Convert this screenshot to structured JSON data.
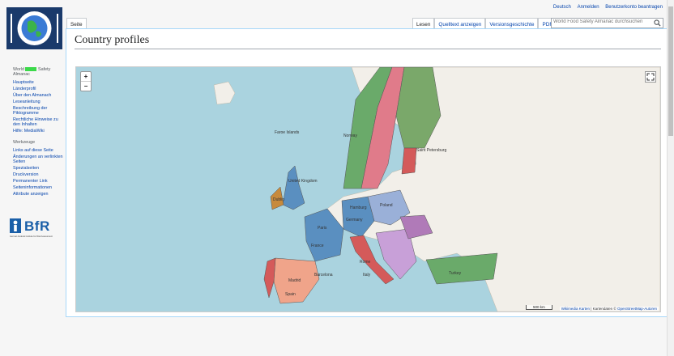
{
  "personal": {
    "language": "Deutsch",
    "login": "Anmelden",
    "account": "Benutzerkonto beantragen"
  },
  "tabs": {
    "page": "Seite",
    "read": "Lesen",
    "source": "Quelltext anzeigen",
    "history": "Versionsgeschichte",
    "pdf": "PDF-Export"
  },
  "search": {
    "placeholder": "World Food Safety Almanac durchsuchen"
  },
  "page": {
    "title": "Country profiles"
  },
  "sidebar": {
    "site_title_pre": "World",
    "site_title_post": "Safety Almanac",
    "nav": [
      "Hauptseite",
      "Länderprofil",
      "Über den Almanach",
      "Leseanleitung",
      "Beschreibung der Piktogramme",
      "Rechtliche Hinweise zu den Inhalten",
      "Hilfe: MediaWiki"
    ],
    "tools_heading": "Werkzeuge",
    "tools": [
      "Links auf diese Seite",
      "Änderungen an verlinkten Seiten",
      "Spezialseiten",
      "Druckversion",
      "Permanenter Link",
      "Seiteninformationen",
      "Attribute anzeigen"
    ]
  },
  "bfr": {
    "text": "BfR",
    "subtitle": "German Federal Institute for Risk Assessment"
  },
  "map": {
    "zoom_in": "+",
    "zoom_out": "−",
    "scale": "500 km",
    "attribution_maps": "Wikimedia Karten",
    "attribution_sep": " | Kartendaten © ",
    "attribution_osm": "OpenStreetMap-Autoren",
    "labels": {
      "faroe": "Faroe Islands",
      "norway": "Norway",
      "united_kingdom": "United Kingdom",
      "hamburg": "Hamburg",
      "germany": "Germany",
      "paris": "Paris",
      "france": "France",
      "madrid": "Madrid",
      "spain": "Spain",
      "barcelona": "Barcelona",
      "rome": "Rome",
      "italy": "Italy",
      "saint_petersburg": "Saint Petersburg",
      "turkey": "Turkey",
      "dublin": "Dublin",
      "poland": "Poland"
    }
  },
  "colors": {
    "sea": "#aad3df",
    "land": "#f2efe9",
    "link": "#0645ad"
  }
}
